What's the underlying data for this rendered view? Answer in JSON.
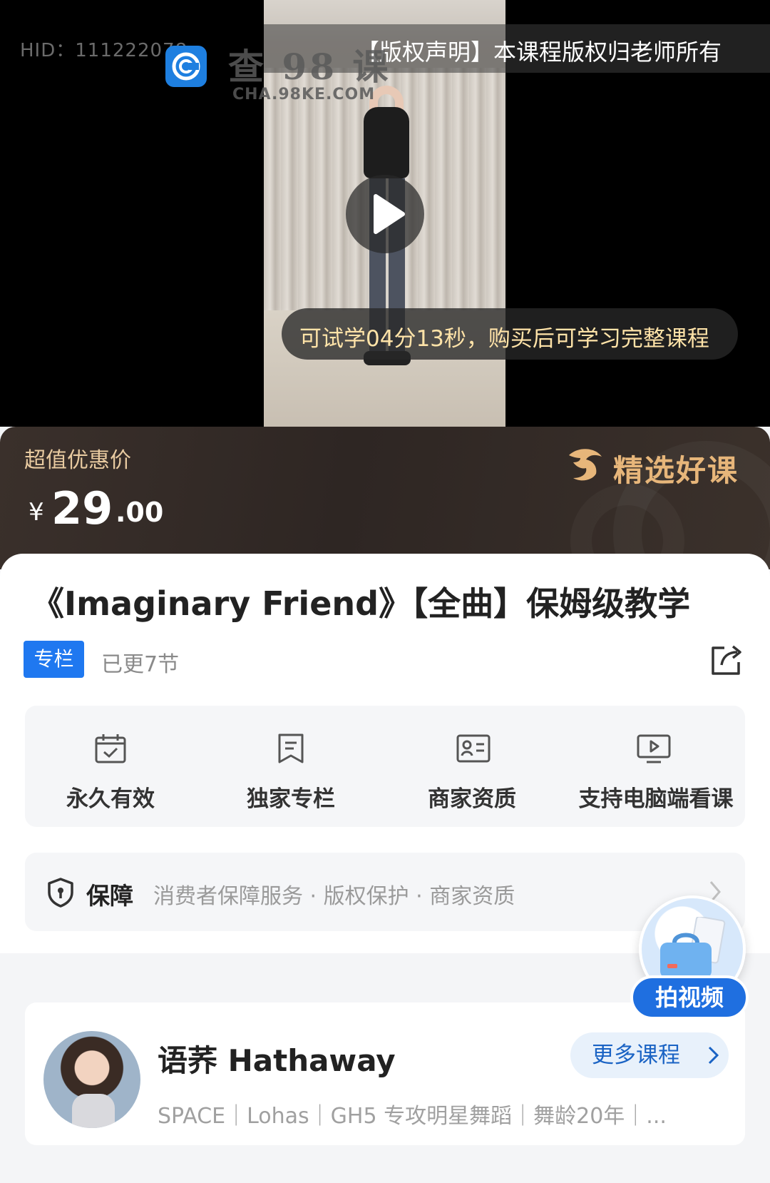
{
  "video": {
    "watermark_hid": "HID：111222078",
    "watermark_site_cn": "查 98 课",
    "watermark_site_en": "CHA.98KE.COM",
    "copyright_notice": "【版权声明】本课程版权归老师所有",
    "trial_notice": "可试学04分13秒，购买后可学习完整课程"
  },
  "price": {
    "label": "超值优惠价",
    "currency": "¥",
    "integer": "29",
    "decimal": ".00",
    "featured_badge": "精选好课"
  },
  "course": {
    "title": "《Imaginary Friend》【全曲】保姆级教学",
    "tag": "专栏",
    "updated": "已更7节"
  },
  "features": [
    {
      "label": "永久有效",
      "icon": "calendar-check-icon"
    },
    {
      "label": "独家专栏",
      "icon": "bookmark-icon"
    },
    {
      "label": "商家资质",
      "icon": "id-card-icon"
    },
    {
      "label": "支持电脑端看课",
      "icon": "monitor-play-icon"
    }
  ],
  "guarantee": {
    "title": "保障",
    "items": "消费者保障服务 · 版权保护 · 商家资质"
  },
  "teacher": {
    "name": "语荞 Hathaway",
    "bio": "SPACE｜Lohas｜GH5 专攻明星舞蹈｜舞龄20年｜...",
    "more_label": "更多课程"
  },
  "floating": {
    "shoot_label": "拍视频"
  },
  "colors": {
    "accent_blue": "#1f78f0",
    "price_banner_bg": "#2e2623",
    "gold": "#e7b67a"
  }
}
